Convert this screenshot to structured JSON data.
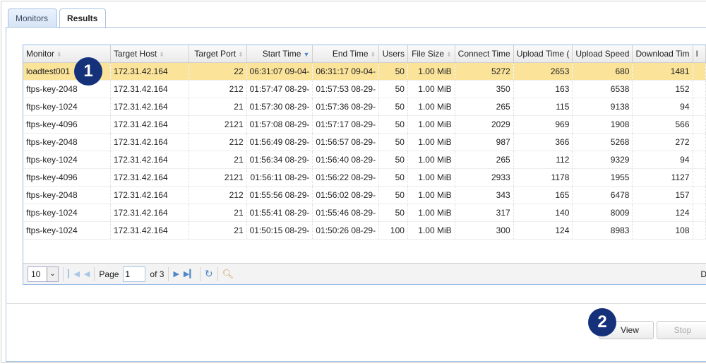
{
  "tabs": [
    {
      "label": "Monitors",
      "active": false
    },
    {
      "label": "Results",
      "active": true
    }
  ],
  "grid": {
    "columns": [
      {
        "label": "Monitor",
        "sort": "none"
      },
      {
        "label": "Target Host",
        "sort": "none"
      },
      {
        "label": "Target Port",
        "sort": "none"
      },
      {
        "label": "Start Time",
        "sort": "desc"
      },
      {
        "label": "End Time",
        "sort": "none"
      },
      {
        "label": "Users"
      },
      {
        "label": "File Size",
        "sort": "none"
      },
      {
        "label": "Connect Time"
      },
      {
        "label": "Upload Time ("
      },
      {
        "label": "Upload Speed"
      },
      {
        "label": "Download Tim"
      },
      {
        "label": "I"
      }
    ],
    "rows": [
      [
        "loadtest001",
        "172.31.42.164",
        "22",
        "06:31:07 09-04-",
        "06:31:17 09-04-",
        "50",
        "1.00 MiB",
        "5272",
        "2653",
        "680",
        "1481",
        ""
      ],
      [
        "ftps-key-2048",
        "172.31.42.164",
        "212",
        "01:57:47 08-29-",
        "01:57:53 08-29-",
        "50",
        "1.00 MiB",
        "350",
        "163",
        "6538",
        "152",
        ""
      ],
      [
        "ftps-key-1024",
        "172.31.42.164",
        "21",
        "01:57:30 08-29-",
        "01:57:36 08-29-",
        "50",
        "1.00 MiB",
        "265",
        "115",
        "9138",
        "94",
        ""
      ],
      [
        "ftps-key-4096",
        "172.31.42.164",
        "2121",
        "01:57:08 08-29-",
        "01:57:17 08-29-",
        "50",
        "1.00 MiB",
        "2029",
        "969",
        "1908",
        "566",
        ""
      ],
      [
        "ftps-key-2048",
        "172.31.42.164",
        "212",
        "01:56:49 08-29-",
        "01:56:57 08-29-",
        "50",
        "1.00 MiB",
        "987",
        "366",
        "5268",
        "272",
        ""
      ],
      [
        "ftps-key-1024",
        "172.31.42.164",
        "21",
        "01:56:34 08-29-",
        "01:56:40 08-29-",
        "50",
        "1.00 MiB",
        "265",
        "112",
        "9329",
        "94",
        ""
      ],
      [
        "ftps-key-4096",
        "172.31.42.164",
        "2121",
        "01:56:11 08-29-",
        "01:56:22 08-29-",
        "50",
        "1.00 MiB",
        "2933",
        "1178",
        "1955",
        "1127",
        ""
      ],
      [
        "ftps-key-2048",
        "172.31.42.164",
        "212",
        "01:55:56 08-29-",
        "01:56:02 08-29-",
        "50",
        "1.00 MiB",
        "343",
        "165",
        "6478",
        "157",
        ""
      ],
      [
        "ftps-key-1024",
        "172.31.42.164",
        "21",
        "01:55:41 08-29-",
        "01:55:46 08-29-",
        "50",
        "1.00 MiB",
        "317",
        "140",
        "8009",
        "124",
        ""
      ],
      [
        "ftps-key-1024",
        "172.31.42.164",
        "21",
        "01:50:15 08-29-",
        "01:50:26 08-29-",
        "100",
        "1.00 MiB",
        "300",
        "124",
        "8983",
        "108",
        ""
      ]
    ],
    "selected_row": 0
  },
  "pager": {
    "page_size": "10",
    "page_label": "Page",
    "page": "1",
    "of_label": "of 3",
    "right_text": "D"
  },
  "buttons": {
    "view": "View",
    "stop": "Stop"
  },
  "badges": [
    "1",
    "2"
  ],
  "colors": {
    "selected_row": "#fbe49a",
    "badge": "#14317a",
    "accent": "#4f86c6"
  }
}
